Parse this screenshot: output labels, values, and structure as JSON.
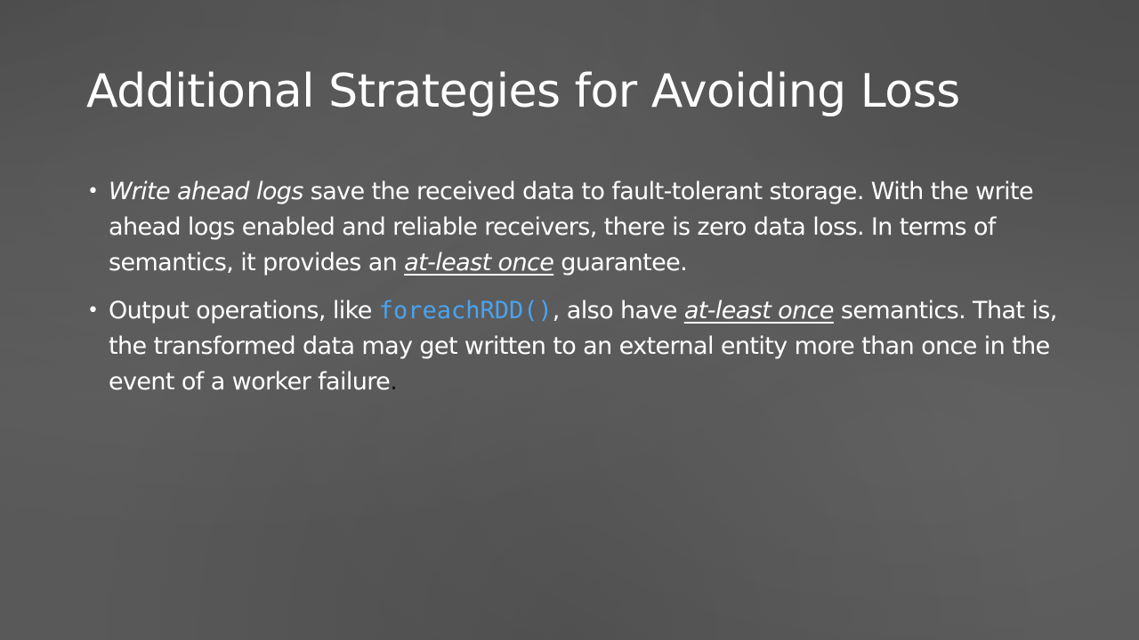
{
  "slide": {
    "title": "Additional Strategies for Avoiding Loss",
    "bullets": [
      {
        "marker": "•",
        "parts": {
          "p1_italic": "Write ahead logs",
          "p2": " save the received data to fault-tolerant storage. With the write ahead logs enabled and reliable receivers, there is zero data loss. In terms of semantics, it provides an ",
          "p3_italic_underline": "at-least once",
          "p4": " guarantee."
        }
      },
      {
        "marker": "•",
        "parts": {
          "p1": "Output operations, like ",
          "p2_code": "foreachRDD()",
          "p3": ", also have ",
          "p4_italic_underline": "at-least once",
          "p5": " semantics. That is, the transformed data may get written to an external entity more than once in the event of a worker failure",
          "p6_dot": "."
        }
      }
    ]
  },
  "colors": {
    "background": "#595959",
    "text": "#ffffff",
    "code": "#4aa3f0"
  }
}
